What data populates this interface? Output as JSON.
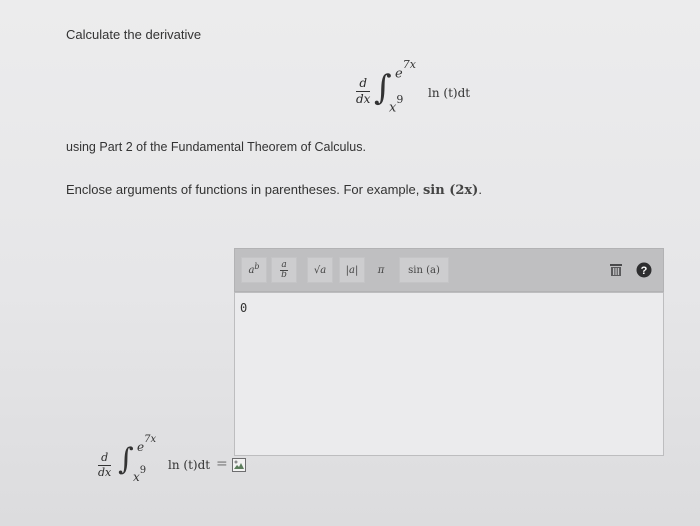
{
  "question": {
    "prompt": "Calculate the derivative",
    "instruction": "using Part 2 of the Fundamental Theorem of Calculus.",
    "hint_text": "Enclose arguments of functions in parentheses. For example,",
    "hint_example": "sin (2x)",
    "hint_end": "."
  },
  "formula": {
    "d_top": "d",
    "d_bottom": "dx",
    "upper_base": "e",
    "upper_exp": "7x",
    "lower_base": "x",
    "lower_exp": "9",
    "integrand": "ln (t)dt"
  },
  "toolbar": {
    "power": "a",
    "power_exp": "b",
    "fraction_top": "a",
    "fraction_bottom": "b",
    "sqrt": "√a",
    "abs": "|a|",
    "pi": "π",
    "sin": "sin (a)"
  },
  "editor": {
    "value": "0"
  },
  "preview": {
    "equals": "="
  },
  "colors": {
    "toolbar_bg": "#bfbfc1",
    "editor_bg": "#ebebed",
    "help_icon": "#2e2e30"
  }
}
